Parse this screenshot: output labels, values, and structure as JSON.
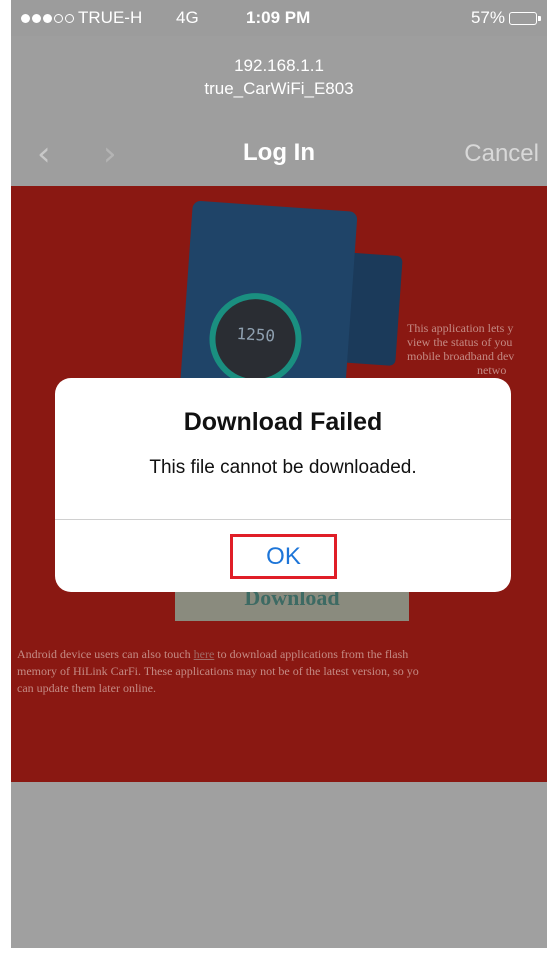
{
  "status_bar": {
    "carrier": "TRUE-H",
    "network": "4G",
    "time": "1:09 PM",
    "battery": "57%",
    "battery_level": 0.57,
    "signal_bars_filled": 3,
    "signal_bars_total": 5
  },
  "address": {
    "host": "192.168.1.1",
    "network_name": "true_CarWiFi_E803"
  },
  "navbar": {
    "back_icon": "chevron-left-icon",
    "forward_icon": "chevron-right-icon",
    "title": "Log In",
    "cancel_label": "Cancel"
  },
  "web_content": {
    "side_text_lines": [
      "This application lets y",
      "view the status of you",
      "mobile broadband dev",
      "netwo"
    ],
    "download_label": "Download",
    "phone_readout": "1250",
    "body_text_lines": [
      "Android device users can also touch",
      "here",
      "to download applications from the flash",
      "memory of HiLink CarFi. These applications may not be of the latest version, so yo",
      "can update them later online."
    ]
  },
  "alert": {
    "title": "Download Failed",
    "message": "This file cannot be downloaded.",
    "ok_label": "OK"
  },
  "colors": {
    "overlay": "#9e9e9e",
    "web_background": "#8a1812",
    "ok_text": "#1d75d8",
    "highlight_box": "#e01e27"
  }
}
